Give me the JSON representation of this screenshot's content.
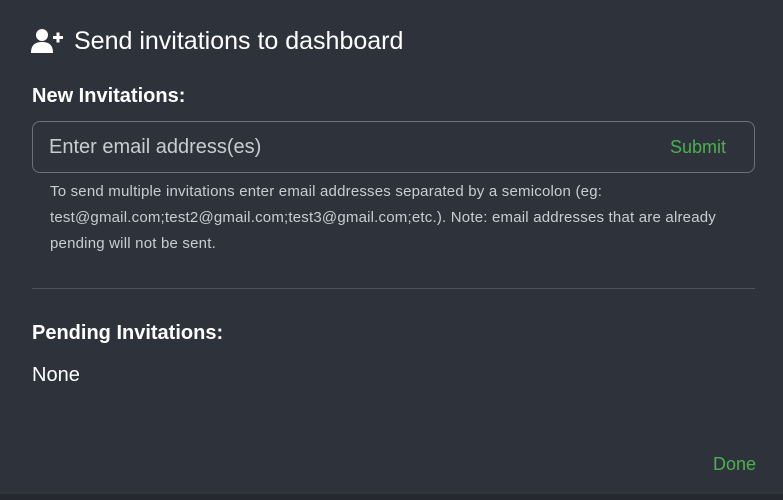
{
  "dialog": {
    "title": "Send invitations to dashboard",
    "title_icon": "user-plus-icon"
  },
  "new_invitations": {
    "heading": "New Invitations:",
    "input_value": "",
    "input_placeholder": "Enter email address(es)",
    "submit_label": "Submit",
    "help_text": "To send multiple invitations enter email addresses separated by a semicolon (eg: test@gmail.com;test2@gmail.com;test3@gmail.com;etc.). Note: email addresses that are already pending will not be sent."
  },
  "pending_invitations": {
    "heading": "Pending Invitations:",
    "value": "None"
  },
  "footer": {
    "done_label": "Done"
  },
  "colors": {
    "background": "#2e333b",
    "accent": "#4caf50",
    "text": "#ffffff",
    "muted_text": "#c9ccd1",
    "input_border": "#6b7079"
  }
}
